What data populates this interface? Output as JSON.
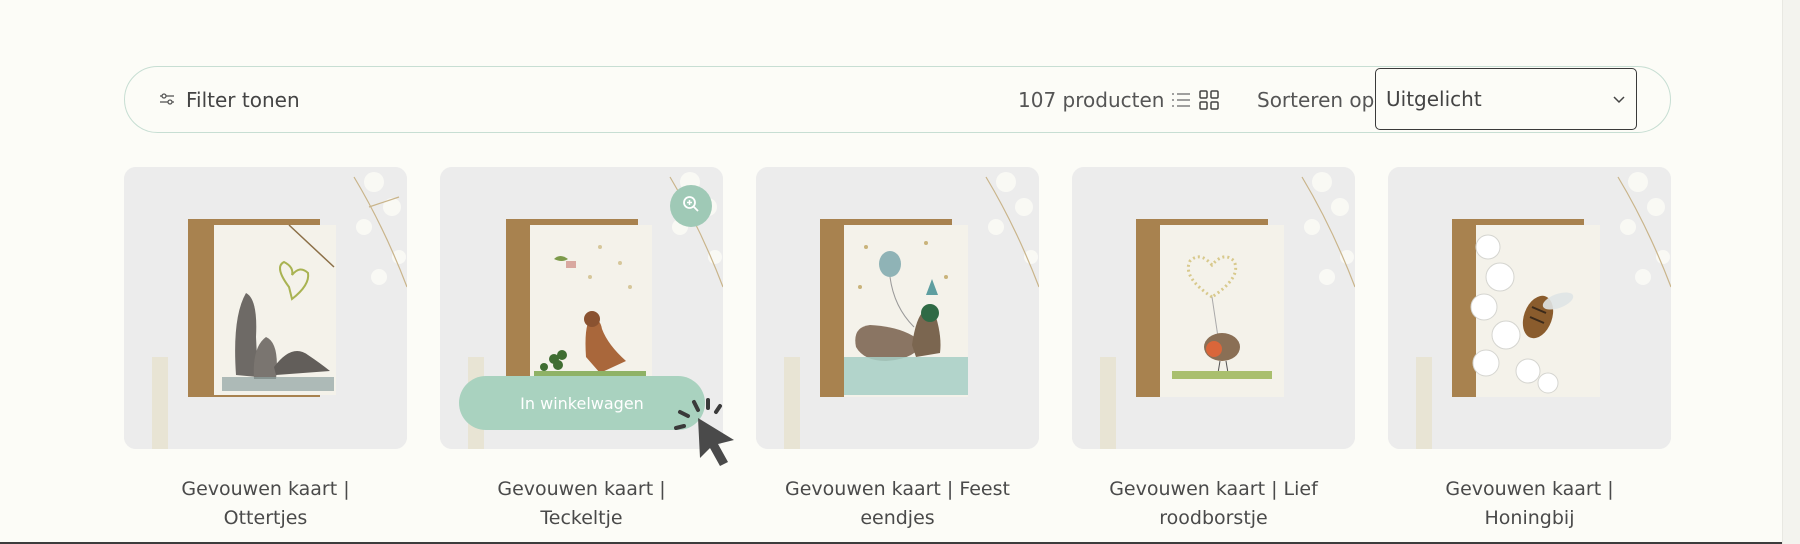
{
  "toolbar": {
    "filter_label": "Filter tonen",
    "product_count": "107 producten",
    "sort_label": "Sorteren op:",
    "sort_value": "Uitgelicht"
  },
  "products": [
    {
      "title": "Gevouwen kaart | Ottertjes",
      "illustration": "otters-heart"
    },
    {
      "title": "Gevouwen kaart | Teckeltje",
      "illustration": "dachshund-bird"
    },
    {
      "title": "Gevouwen kaart | Feest eendjes",
      "illustration": "party-ducks"
    },
    {
      "title": "Gevouwen kaart | Lief roodborstje",
      "illustration": "robin-heart"
    },
    {
      "title": "Gevouwen kaart | Honingbij",
      "illustration": "honeybee-blossom"
    }
  ],
  "hover": {
    "add_to_cart_label": "In winkelwagen"
  },
  "icons": {
    "filter": "sliders-icon",
    "list_view": "list-view-icon",
    "grid_view": "grid-view-icon",
    "sort": "chevron-down-icon",
    "zoom": "zoom-in-icon",
    "cursor": "pointer-cursor-icon"
  },
  "colors": {
    "background": "#fcfcf7",
    "accent": "#a9d2bf",
    "border": "#c7ded3"
  }
}
